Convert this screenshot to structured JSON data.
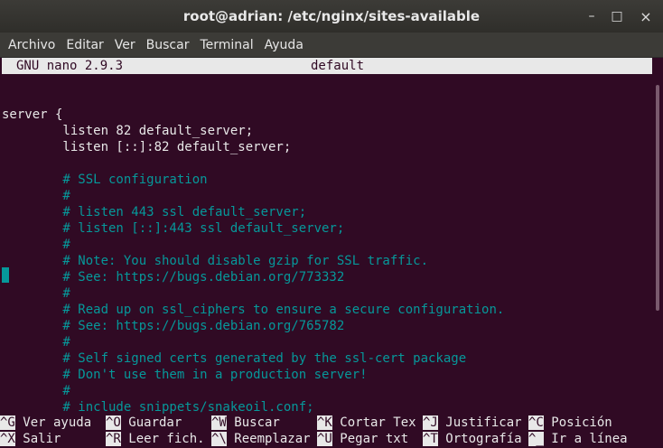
{
  "window": {
    "title": "root@adrian: /etc/nginx/sites-available"
  },
  "controls": {
    "minimize": "–",
    "maximize": "□",
    "close": "×"
  },
  "menu": [
    "Archivo",
    "Editar",
    "Ver",
    "Buscar",
    "Terminal",
    "Ayuda"
  ],
  "nano": {
    "version": "GNU nano 2.9.3",
    "filename": "default"
  },
  "lines": [
    {
      "text": "",
      "type": "code"
    },
    {
      "text": "server {",
      "type": "code"
    },
    {
      "text": "        listen 82 default_server;",
      "type": "code"
    },
    {
      "text": "        listen [::]:82 default_server;",
      "type": "code"
    },
    {
      "text": "",
      "type": "code"
    },
    {
      "text": "        # SSL configuration",
      "type": "comment"
    },
    {
      "text": "        #",
      "type": "comment"
    },
    {
      "text": "        # listen 443 ssl default_server;",
      "type": "comment"
    },
    {
      "text": "        # listen [::]:443 ssl default_server;",
      "type": "comment"
    },
    {
      "text": "        #",
      "type": "comment"
    },
    {
      "text": "        # Note: You should disable gzip for SSL traffic.",
      "type": "comment"
    },
    {
      "text": "        # See: https://bugs.debian.org/773332",
      "type": "comment"
    },
    {
      "text": "        #",
      "type": "comment"
    },
    {
      "text": "        # Read up on ssl_ciphers to ensure a secure configuration.",
      "type": "comment"
    },
    {
      "text": "        # See: https://bugs.debian.org/765782",
      "type": "comment"
    },
    {
      "text": "        #",
      "type": "comment"
    },
    {
      "text": "        # Self signed certs generated by the ssl-cert package",
      "type": "comment"
    },
    {
      "text": "        # Don't use them in a production server!",
      "type": "comment"
    },
    {
      "text": "        #",
      "type": "comment"
    },
    {
      "text": "        # include snippets/snakeoil.conf;",
      "type": "comment"
    }
  ],
  "shortcuts": [
    [
      {
        "key": "^G",
        "label": " Ver ayuda"
      },
      {
        "key": "^O",
        "label": " Guardar"
      },
      {
        "key": "^W",
        "label": " Buscar"
      },
      {
        "key": "^K",
        "label": " Cortar Tex"
      },
      {
        "key": "^J",
        "label": " Justificar"
      },
      {
        "key": "^C",
        "label": " Posición"
      }
    ],
    [
      {
        "key": "^X",
        "label": " Salir"
      },
      {
        "key": "^R",
        "label": " Leer fich."
      },
      {
        "key": "^\\",
        "label": " Reemplazar"
      },
      {
        "key": "^U",
        "label": " Pegar txt"
      },
      {
        "key": "^T",
        "label": " Ortografía"
      },
      {
        "key": "^_",
        "label": " Ir a línea"
      }
    ]
  ]
}
